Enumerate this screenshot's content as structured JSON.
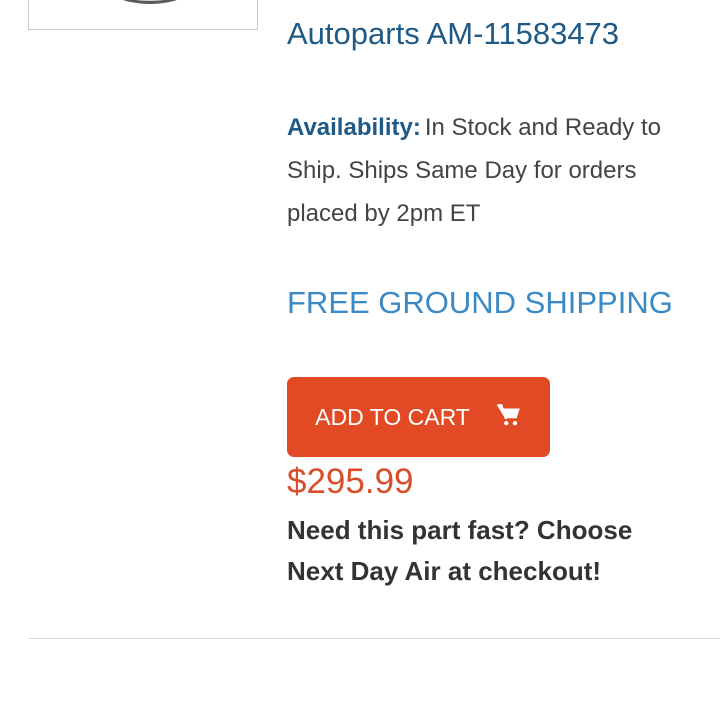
{
  "product": {
    "title": "Autoparts AM-11583473",
    "availability_label": "Availability:",
    "availability_text": "In Stock and Ready to Ship. Ships Same Day for orders placed by 2pm ET",
    "shipping_promo": "FREE GROUND SHIPPING",
    "price": "$295.99",
    "fast_note": "Need this part fast? Choose Next Day Air at checkout!"
  },
  "cart_button": {
    "label": "ADD TO CART",
    "icon": "shopping-cart-icon"
  },
  "colors": {
    "title_blue": "#1f5a86",
    "promo_blue": "#3b8ac6",
    "button_orange": "#e14a25",
    "price_orange": "#d94e2a"
  }
}
